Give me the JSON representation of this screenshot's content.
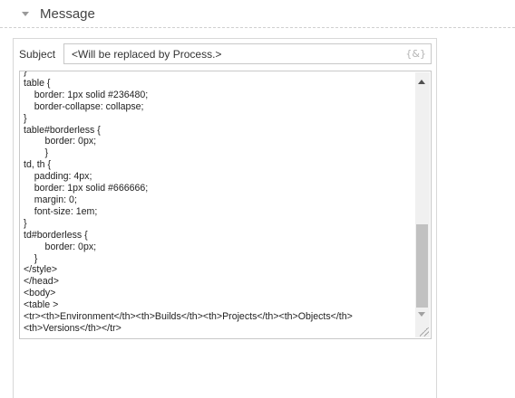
{
  "section": {
    "title": "Message"
  },
  "subject": {
    "label": "Subject",
    "value": "<Will be replaced by Process.>",
    "variable_icon": "{&}"
  },
  "body": {
    "code": "}\ntable {\n\tborder: 1px solid #236480;\n\tborder-collapse: collapse;\n}\ntable#borderless {\n\t\tborder: 0px;\n\t\t}\ntd, th {\n\tpadding: 4px;\n\tborder: 1px solid #666666;\n\tmargin: 0;\n\tfont-size: 1em;\n}\ntd#borderless {\n\t\tborder: 0px;\n\t}\n</style>\n</head>\n<body>\n<table >\n<tr><th>Environment</th><th>Builds</th><th>Projects</th><th>Objects</th>\n<th>Versions</th></tr>"
  },
  "colors": {
    "border": "#c8c8c8",
    "scrollbar_thumb": "#c1c1c1",
    "text": "#222222"
  }
}
